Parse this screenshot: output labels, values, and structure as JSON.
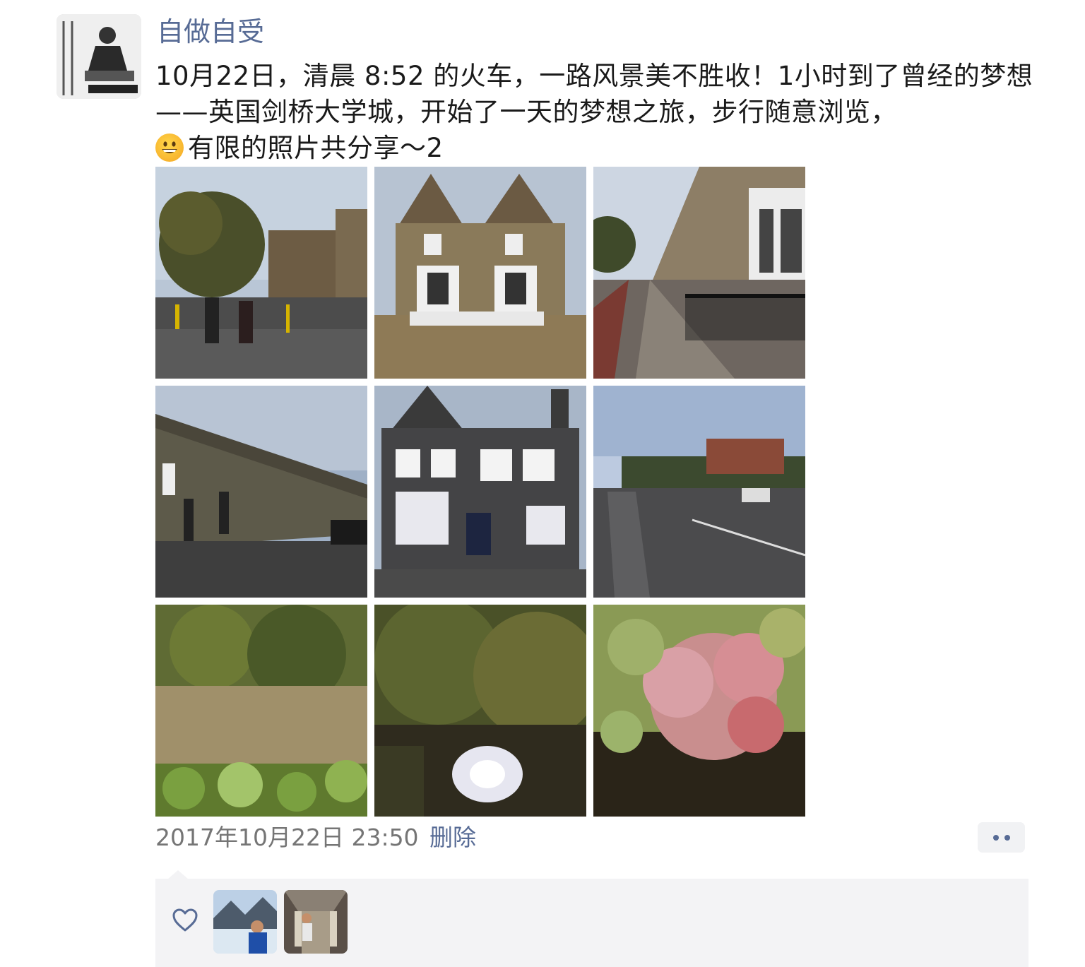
{
  "post": {
    "author": "自做自受",
    "text_part1": "10月22日，清晨 8:52 的火车，一路风景美不胜收！1小时到了曾经的梦想——英国剑桥大学城，开始了一天的梦想之旅，步行随意浏览，",
    "emoji": "grinning-face-emoji",
    "text_part2": "有限的照片共分享～2",
    "photo_count": 9,
    "timestamp": "2017年10月22日 23:50",
    "delete_label": "删除"
  },
  "likes": {
    "icon": "heart-icon",
    "likers": [
      "liker-avatar-1",
      "liker-avatar-2"
    ]
  },
  "colors": {
    "link": "#576b95",
    "secondary_text": "#757575",
    "like_bg": "#f3f3f5"
  }
}
